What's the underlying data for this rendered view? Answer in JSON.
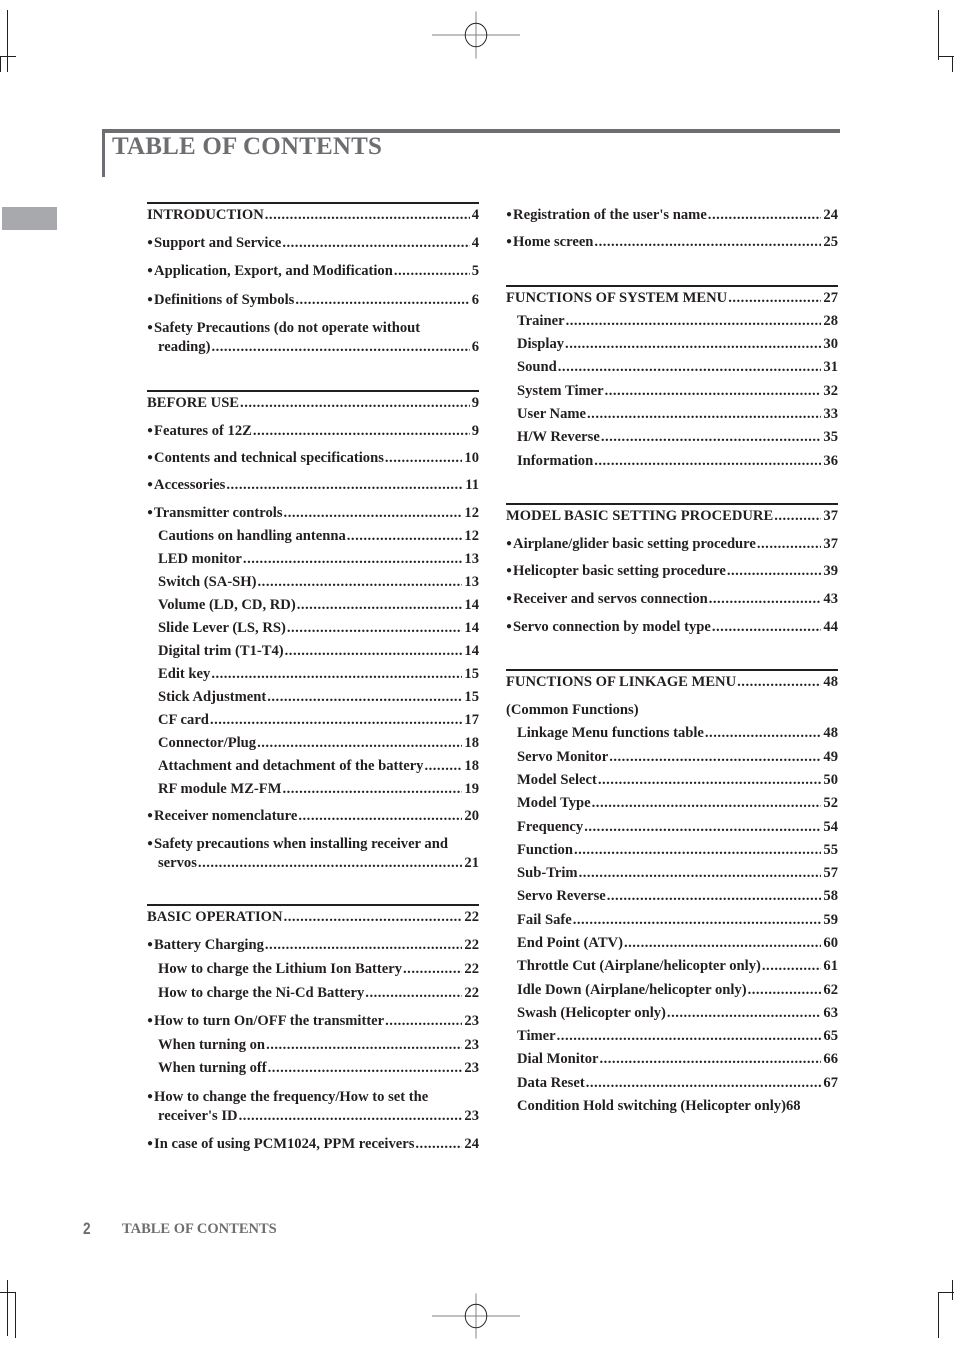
{
  "header": {
    "title": "TABLE OF CONTENTS"
  },
  "left_column": [
    {
      "type": "section",
      "label": "INTRODUCTION",
      "page": "4"
    },
    {
      "type": "bullet",
      "label": "Support and Service",
      "page": "4"
    },
    {
      "type": "bullet",
      "label": "Application, Export, and Modification",
      "page": "5"
    },
    {
      "type": "bullet",
      "label": "Definitions of Symbols",
      "page": "6"
    },
    {
      "type": "bullet-wrap",
      "label": "Safety Precautions (do not operate without",
      "label2": "reading)",
      "page": "6"
    },
    {
      "type": "section",
      "label": "BEFORE USE",
      "page": "9"
    },
    {
      "type": "bullet",
      "label": "Features of 12Z",
      "page": "9"
    },
    {
      "type": "bullet",
      "label": "Contents and technical specifications",
      "page": "10"
    },
    {
      "type": "bullet",
      "label": "Accessories",
      "page": "11"
    },
    {
      "type": "bullet",
      "label": "Transmitter controls",
      "page": "12"
    },
    {
      "type": "sub",
      "label": "Cautions on handling antenna",
      "page": "12"
    },
    {
      "type": "sub",
      "label": "LED monitor",
      "page": "13"
    },
    {
      "type": "sub",
      "label": "Switch (SA-SH)",
      "page": "13"
    },
    {
      "type": "sub",
      "label": "Volume (LD, CD, RD)",
      "page": "14"
    },
    {
      "type": "sub",
      "label": "Slide Lever (LS, RS)",
      "page": "14"
    },
    {
      "type": "sub",
      "label": "Digital trim (T1-T4)",
      "page": "14"
    },
    {
      "type": "sub",
      "label": "Edit key",
      "page": "15"
    },
    {
      "type": "sub",
      "label": "Stick Adjustment",
      "page": "15"
    },
    {
      "type": "sub",
      "label": "CF card",
      "page": "17"
    },
    {
      "type": "sub",
      "label": "Connector/Plug",
      "page": "18"
    },
    {
      "type": "sub",
      "label": "Attachment and detachment of the battery",
      "page": "18"
    },
    {
      "type": "sub",
      "label": "RF module MZ-FM",
      "page": "19"
    },
    {
      "type": "bullet",
      "label": "Receiver nomenclature",
      "page": "20"
    },
    {
      "type": "bullet-wrap",
      "label": "Safety precautions when installing receiver and",
      "label2": "servos",
      "page": "21"
    },
    {
      "type": "section",
      "label": "BASIC OPERATION",
      "page": "22"
    },
    {
      "type": "bullet",
      "label": "Battery Charging",
      "page": "22"
    },
    {
      "type": "sub",
      "label": "How to charge the Lithium Ion Battery",
      "page": "22"
    },
    {
      "type": "sub",
      "label": "How to charge the Ni-Cd Battery",
      "page": "22"
    },
    {
      "type": "bullet",
      "label": "How to turn On/OFF the transmitter",
      "page": "23"
    },
    {
      "type": "sub",
      "label": "When turning on",
      "page": "23"
    },
    {
      "type": "sub",
      "label": "When turning off",
      "page": "23"
    },
    {
      "type": "bullet-wrap",
      "label": "How to change the frequency/How to set the",
      "label2": "receiver's ID",
      "page": "23"
    },
    {
      "type": "bullet",
      "label": "In case of using PCM1024, PPM receivers",
      "page": "24"
    }
  ],
  "right_column": [
    {
      "type": "bullet",
      "label": "Registration of the user's name",
      "page": "24"
    },
    {
      "type": "bullet",
      "label": "Home screen",
      "page": "25"
    },
    {
      "type": "section",
      "label": "FUNCTIONS OF SYSTEM MENU",
      "page": "27"
    },
    {
      "type": "sub",
      "label": "Trainer",
      "page": "28"
    },
    {
      "type": "sub",
      "label": "Display",
      "page": "30"
    },
    {
      "type": "sub",
      "label": "Sound",
      "page": "31"
    },
    {
      "type": "sub",
      "label": "System Timer",
      "page": "32"
    },
    {
      "type": "sub",
      "label": "User Name",
      "page": "33"
    },
    {
      "type": "sub",
      "label": "H/W Reverse",
      "page": "35"
    },
    {
      "type": "sub",
      "label": "Information",
      "page": "36"
    },
    {
      "type": "section",
      "label": "MODEL BASIC SETTING PROCEDURE",
      "page": "37"
    },
    {
      "type": "bullet",
      "label": "Airplane/glider basic setting procedure",
      "page": "37"
    },
    {
      "type": "bullet",
      "label": "Helicopter basic setting procedure",
      "page": "39"
    },
    {
      "type": "bullet",
      "label": "Receiver and servos connection",
      "page": "43"
    },
    {
      "type": "bullet",
      "label": "Servo connection by model type",
      "page": "44"
    },
    {
      "type": "section",
      "label": "FUNCTIONS OF LINKAGE MENU",
      "page": "48"
    },
    {
      "type": "heading",
      "label": "(Common Functions)",
      "page": ""
    },
    {
      "type": "sub",
      "label": "Linkage Menu functions table",
      "page": "48"
    },
    {
      "type": "sub",
      "label": "Servo Monitor",
      "page": "49"
    },
    {
      "type": "sub",
      "label": "Model Select",
      "page": "50"
    },
    {
      "type": "sub",
      "label": "Model Type",
      "page": "52"
    },
    {
      "type": "sub",
      "label": "Frequency",
      "page": "54"
    },
    {
      "type": "sub",
      "label": "Function",
      "page": "55"
    },
    {
      "type": "sub",
      "label": "Sub-Trim",
      "page": "57"
    },
    {
      "type": "sub",
      "label": "Servo Reverse",
      "page": "58"
    },
    {
      "type": "sub",
      "label": "Fail Safe",
      "page": "59"
    },
    {
      "type": "sub",
      "label": "End Point (ATV)",
      "page": "60"
    },
    {
      "type": "sub",
      "label": "Throttle Cut (Airplane/helicopter only)",
      "page": "61"
    },
    {
      "type": "sub",
      "label": "Idle Down (Airplane/helicopter only)",
      "page": "62"
    },
    {
      "type": "sub",
      "label": "Swash (Helicopter only)",
      "page": "63"
    },
    {
      "type": "sub",
      "label": "Timer",
      "page": "65"
    },
    {
      "type": "sub",
      "label": "Dial Monitor",
      "page": "66"
    },
    {
      "type": "sub",
      "label": "Data Reset",
      "page": "67"
    },
    {
      "type": "sub-nodots",
      "label": "Condition Hold switching (Helicopter only)",
      "page": "68"
    }
  ],
  "footer": {
    "page_number": "2",
    "running_title": "TABLE OF CONTENTS"
  }
}
